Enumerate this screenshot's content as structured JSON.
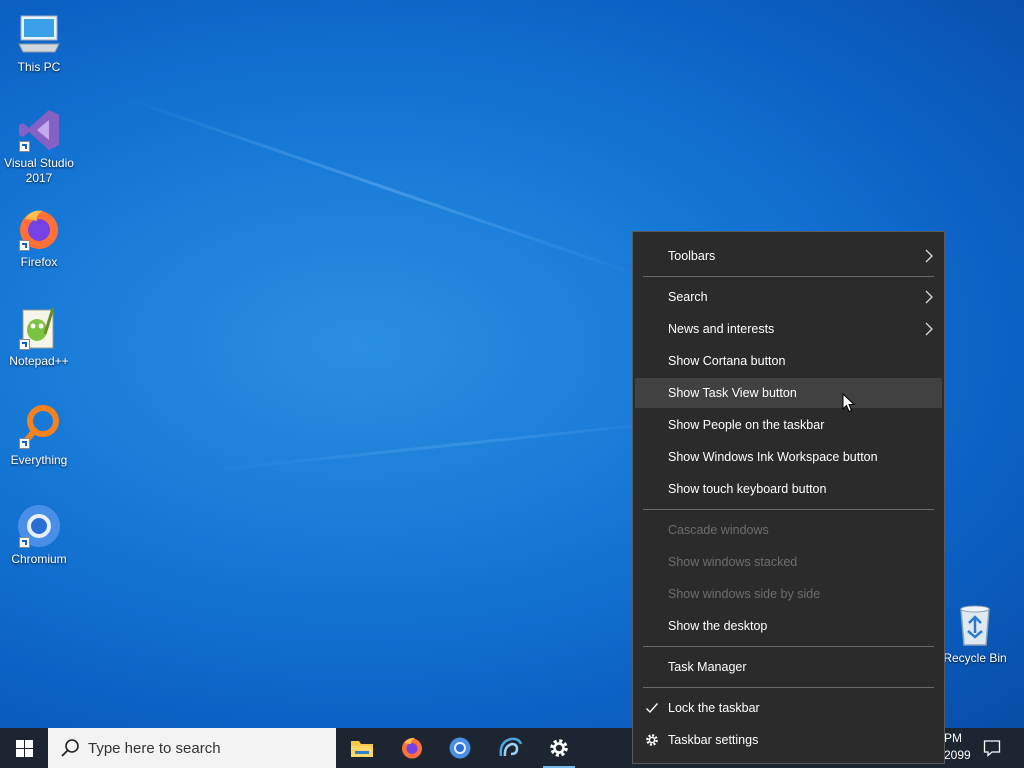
{
  "desktop": {
    "icons": [
      {
        "label": "This PC",
        "icon": "computer-icon"
      },
      {
        "label": "Visual Studio 2017",
        "icon": "visual-studio-icon"
      },
      {
        "label": "Firefox",
        "icon": "firefox-icon"
      },
      {
        "label": "Notepad++",
        "icon": "notepadpp-icon"
      },
      {
        "label": "Everything",
        "icon": "everything-icon"
      },
      {
        "label": "Chromium",
        "icon": "chromium-icon"
      },
      {
        "label": "Recycle Bin",
        "icon": "recycle-bin-icon"
      }
    ]
  },
  "taskbar": {
    "search_placeholder": "Type here to search",
    "apps": [
      {
        "name": "File Explorer",
        "icon": "folder-icon"
      },
      {
        "name": "Firefox",
        "icon": "firefox-icon"
      },
      {
        "name": "Chromium",
        "icon": "chromium-icon"
      },
      {
        "name": "App",
        "icon": "swirl-app-icon"
      },
      {
        "name": "Settings",
        "icon": "gear-icon"
      }
    ],
    "clock": {
      "time": "PM",
      "date": "2099"
    }
  },
  "context_menu": {
    "items": [
      {
        "label": "Toolbars",
        "submenu": true
      },
      {
        "label": "Search",
        "submenu": true
      },
      {
        "label": "News and interests",
        "submenu": true
      },
      {
        "label": "Show Cortana button"
      },
      {
        "label": "Show Task View button",
        "hovered": true
      },
      {
        "label": "Show People on the taskbar"
      },
      {
        "label": "Show Windows Ink Workspace button"
      },
      {
        "label": "Show touch keyboard button"
      },
      {
        "label": "Cascade windows",
        "disabled": true
      },
      {
        "label": "Show windows stacked",
        "disabled": true
      },
      {
        "label": "Show windows side by side",
        "disabled": true
      },
      {
        "label": "Show the desktop"
      },
      {
        "label": "Task Manager"
      },
      {
        "label": "Lock the taskbar",
        "checked": true
      },
      {
        "label": "Taskbar settings",
        "icon": "gear-icon"
      }
    ]
  },
  "colors": {
    "menu_bg": "#2b2b2b",
    "menu_hover": "#414141",
    "menu_disabled_text": "#6d6d6d",
    "taskbar_bg": "#1c2530",
    "desktop_blue": "#1678d6"
  }
}
